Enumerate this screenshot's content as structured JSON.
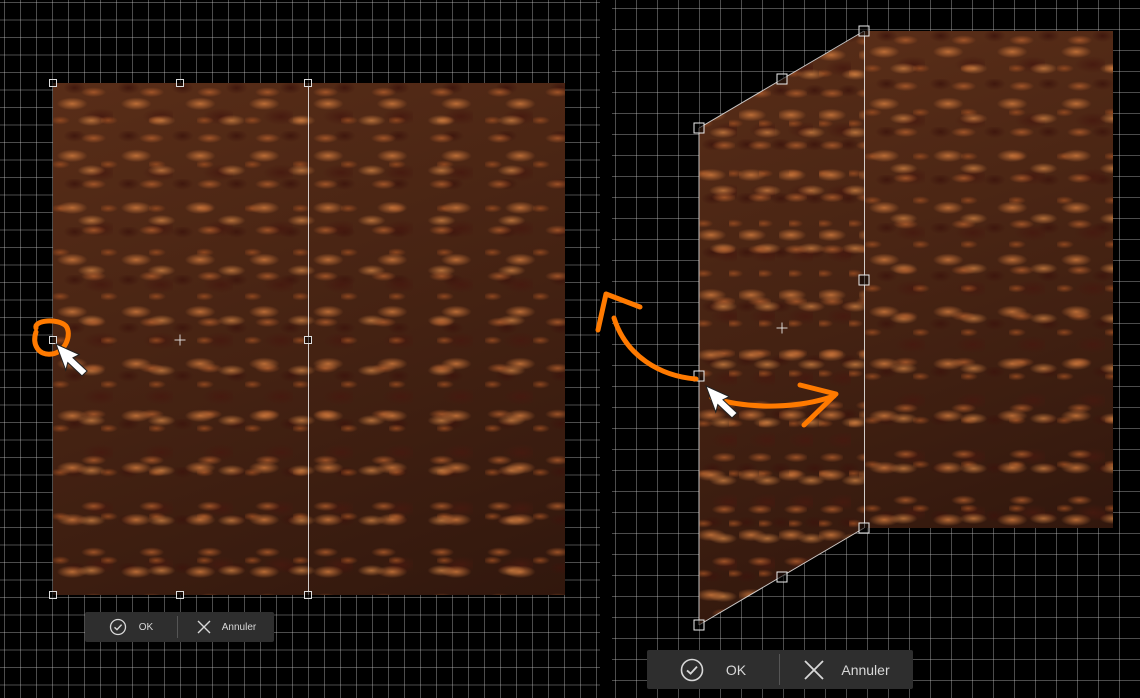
{
  "left_panel": {
    "action_bar": {
      "ok_label": "OK",
      "cancel_label": "Annuler",
      "ok_icon": "check-circle-icon",
      "cancel_icon": "x-icon"
    },
    "annotation": {
      "color": "#ff7a00",
      "kind": "circle-highlight"
    }
  },
  "right_panel": {
    "action_bar": {
      "ok_label": "OK",
      "cancel_label": "Annuler",
      "ok_icon": "check-circle-icon",
      "cancel_icon": "x-icon"
    },
    "annotation": {
      "color": "#ff7a00",
      "kind": "curved-arrows"
    }
  },
  "colors": {
    "background": "#000000",
    "grid": "#c8c8c8",
    "accent": "#ff7a00",
    "toolbar": "#2e2e2e",
    "toolbar_text": "#d8d8d8"
  }
}
